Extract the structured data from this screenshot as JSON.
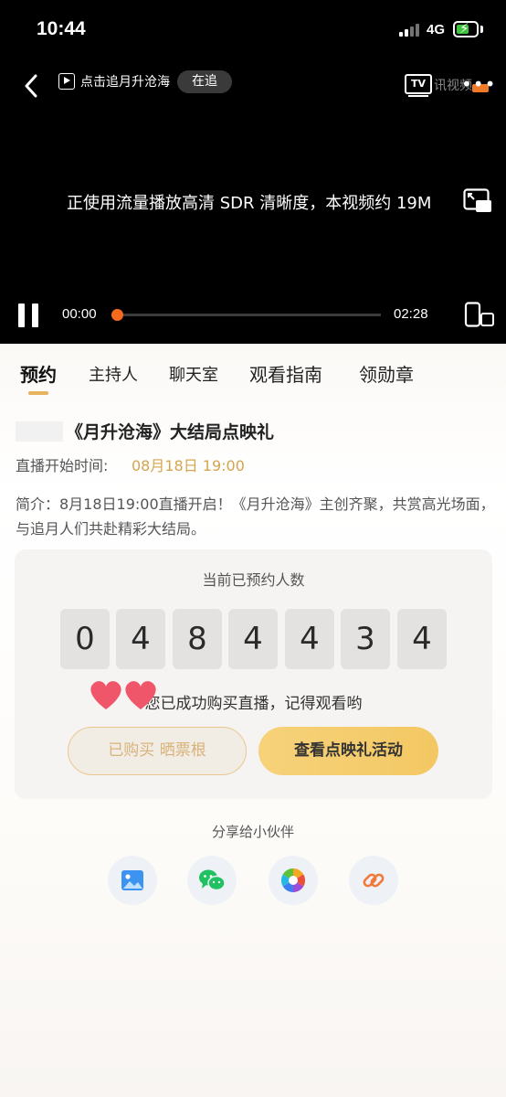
{
  "status_bar": {
    "time": "10:44",
    "network": "4G",
    "battery_level": 0.6,
    "battery_color": "#3ec43c"
  },
  "player": {
    "follow_text": "点击追月升沧海",
    "follow_badge": "在追",
    "tv_logo": "TV",
    "brand_text": "讯视频",
    "notice": "正使用流量播放高清 SDR 清晰度，本视频约 19M",
    "current_time": "00:00",
    "total_time": "02:28",
    "progress": 0.0,
    "accent_color": "#f56a1e",
    "icons": [
      "back-arrow-icon",
      "play-icon",
      "tv-logo-icon",
      "more-icon",
      "pip-icon",
      "pause-icon",
      "rotate-screen-icon"
    ]
  },
  "tabs": [
    {
      "label": "预约",
      "active": true
    },
    {
      "label": "主持人",
      "active": false
    },
    {
      "label": "聊天室",
      "active": false
    },
    {
      "label": "观看指南",
      "active": false
    },
    {
      "label": "领勋章",
      "active": false
    }
  ],
  "event": {
    "title": "《月升沧海》大结局点映礼",
    "start_label": "直播开始时间:",
    "start_value": "08月18日 19:00",
    "intro": "简介：8月18日19:00直播开启！《月升沧海》主创齐聚，共赏高光场面，与追月人们共赴精彩大结局。"
  },
  "reservation": {
    "title": "当前已预约人数",
    "digits": [
      "0",
      "4",
      "8",
      "4",
      "4",
      "3",
      "4"
    ],
    "message": "您已成功购买直播，记得观看哟",
    "bought_button": "已购买 晒票根",
    "activity_button": "查看点映礼活动",
    "heart_color": "#f0566a",
    "accent_color": "#f3c863"
  },
  "share": {
    "title": "分享给小伙伴",
    "targets": [
      {
        "icon": "image-icon",
        "color": "#3c94f0"
      },
      {
        "icon": "wechat-icon",
        "color": "#1fc160"
      },
      {
        "icon": "moments-icon",
        "color": "#f5a623"
      },
      {
        "icon": "link-icon",
        "color": "#f07a3c"
      }
    ]
  }
}
